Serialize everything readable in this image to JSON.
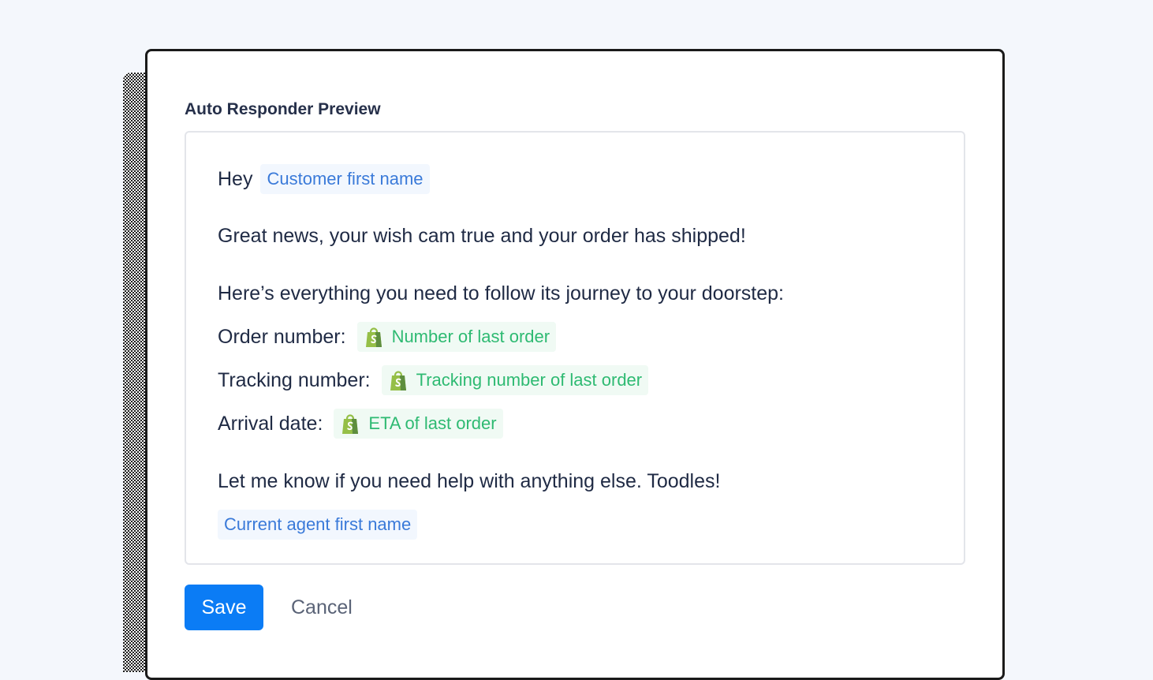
{
  "preview": {
    "title": "Auto Responder Preview",
    "greeting": "Hey",
    "customer_tag": "Customer first name",
    "line_shipped": "Great news, your wish cam true and your order has shipped!",
    "line_follow": "Here’s everything you need to follow its journey to your doorstep:",
    "order_label": "Order number:",
    "order_tag": "Number of last order",
    "tracking_label": "Tracking number:",
    "tracking_tag": "Tracking number of last order",
    "arrival_label": "Arrival date:",
    "arrival_tag": "ETA of last order",
    "line_closing": "Let me know if you need help with anything else. Toodles!",
    "agent_tag": "Current agent first name"
  },
  "actions": {
    "save_label": "Save",
    "cancel_label": "Cancel"
  },
  "colors": {
    "primary": "#0b7cf5",
    "variable_blue": "#3a7ad9",
    "variable_green": "#2eba72",
    "shopify_green": "#95bf47"
  },
  "icons": {
    "shopify": "shopify-bag-icon"
  }
}
